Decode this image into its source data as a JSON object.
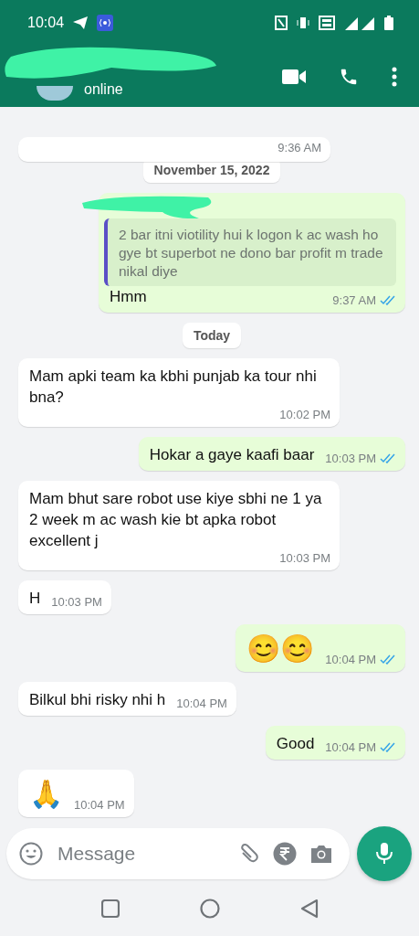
{
  "status_bar": {
    "time": "10:04"
  },
  "header": {
    "status": "online"
  },
  "messages": [
    {
      "kind": "cut",
      "time": "9:36 AM"
    },
    {
      "kind": "date",
      "text": "November 15, 2022"
    },
    {
      "kind": "outgoing",
      "quote": "2 bar itni viotility hui k logon k ac wash ho gye bt superbot ne dono bar profit m trade nikal diye",
      "text": "Hmm",
      "time": "9:37 AM",
      "read": true
    },
    {
      "kind": "date",
      "text": "Today"
    },
    {
      "kind": "incoming",
      "text": "Mam apki team ka kbhi punjab ka tour nhi bna?",
      "time": "10:02 PM"
    },
    {
      "kind": "outgoing",
      "text": "Hokar a gaye kaafi baar",
      "time": "10:03 PM",
      "read": true
    },
    {
      "kind": "incoming",
      "text": "Mam bhut sare robot use kiye sbhi ne 1 ya 2 week m ac wash kie bt apka robot excellent j",
      "time": "10:03 PM"
    },
    {
      "kind": "incoming",
      "text": "H",
      "time": "10:03 PM"
    },
    {
      "kind": "outgoing",
      "text": "😊😊",
      "emoji": true,
      "time": "10:04 PM",
      "read": true
    },
    {
      "kind": "incoming",
      "text": "Bilkul bhi risky nhi h",
      "time": "10:04 PM"
    },
    {
      "kind": "outgoing",
      "text": "Good",
      "time": "10:04 PM",
      "read": true
    },
    {
      "kind": "incoming",
      "text": "🙏",
      "emoji": true,
      "time": "10:04 PM"
    }
  ],
  "composer": {
    "placeholder": "Message"
  }
}
